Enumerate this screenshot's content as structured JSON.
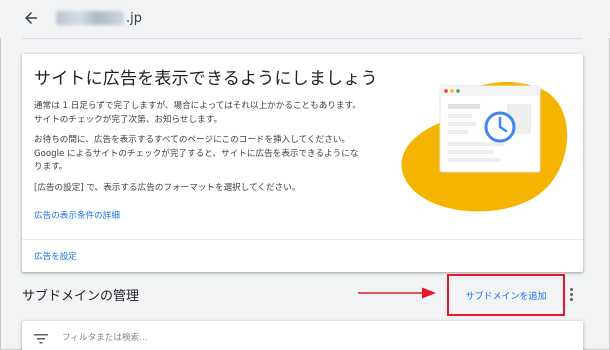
{
  "header": {
    "back_icon": "arrow-left-icon",
    "domain_suffix": ".jp"
  },
  "card": {
    "title": "サイトに広告を表示できるようにしましょう",
    "paragraphs": [
      "通常は 1 日足らずで完了しますが、場合によってはそれ以上かかることもあります。\nサイトのチェックが完了次第、お知らせします。",
      "お待ちの間に、広告を表示するすべてのページにこのコードを挿入してください。\nGoogle によるサイトのチェックが完了すると、サイトに広告を表示できるようにな\nります。",
      "[広告の設定] で、表示する広告のフォーマットを選択してください。"
    ],
    "details_link": "広告の表示条件の詳細",
    "action_link": "広告を設定"
  },
  "subdomains": {
    "section_title": "サブドメインの管理",
    "add_button_label": "サブドメインを追加",
    "more_icon": "more-vert-icon",
    "filter_icon": "filter-list-icon",
    "filter_placeholder": "フィルタまたは検索..."
  },
  "colors": {
    "accent_link": "#1a73e8",
    "highlight_box": "#e8162a",
    "illustration_blob": "#f4b400",
    "clock_blue": "#4285f4",
    "background": "#f1f3f4"
  },
  "illustration": {
    "icon": "browser-clock-illustration"
  }
}
